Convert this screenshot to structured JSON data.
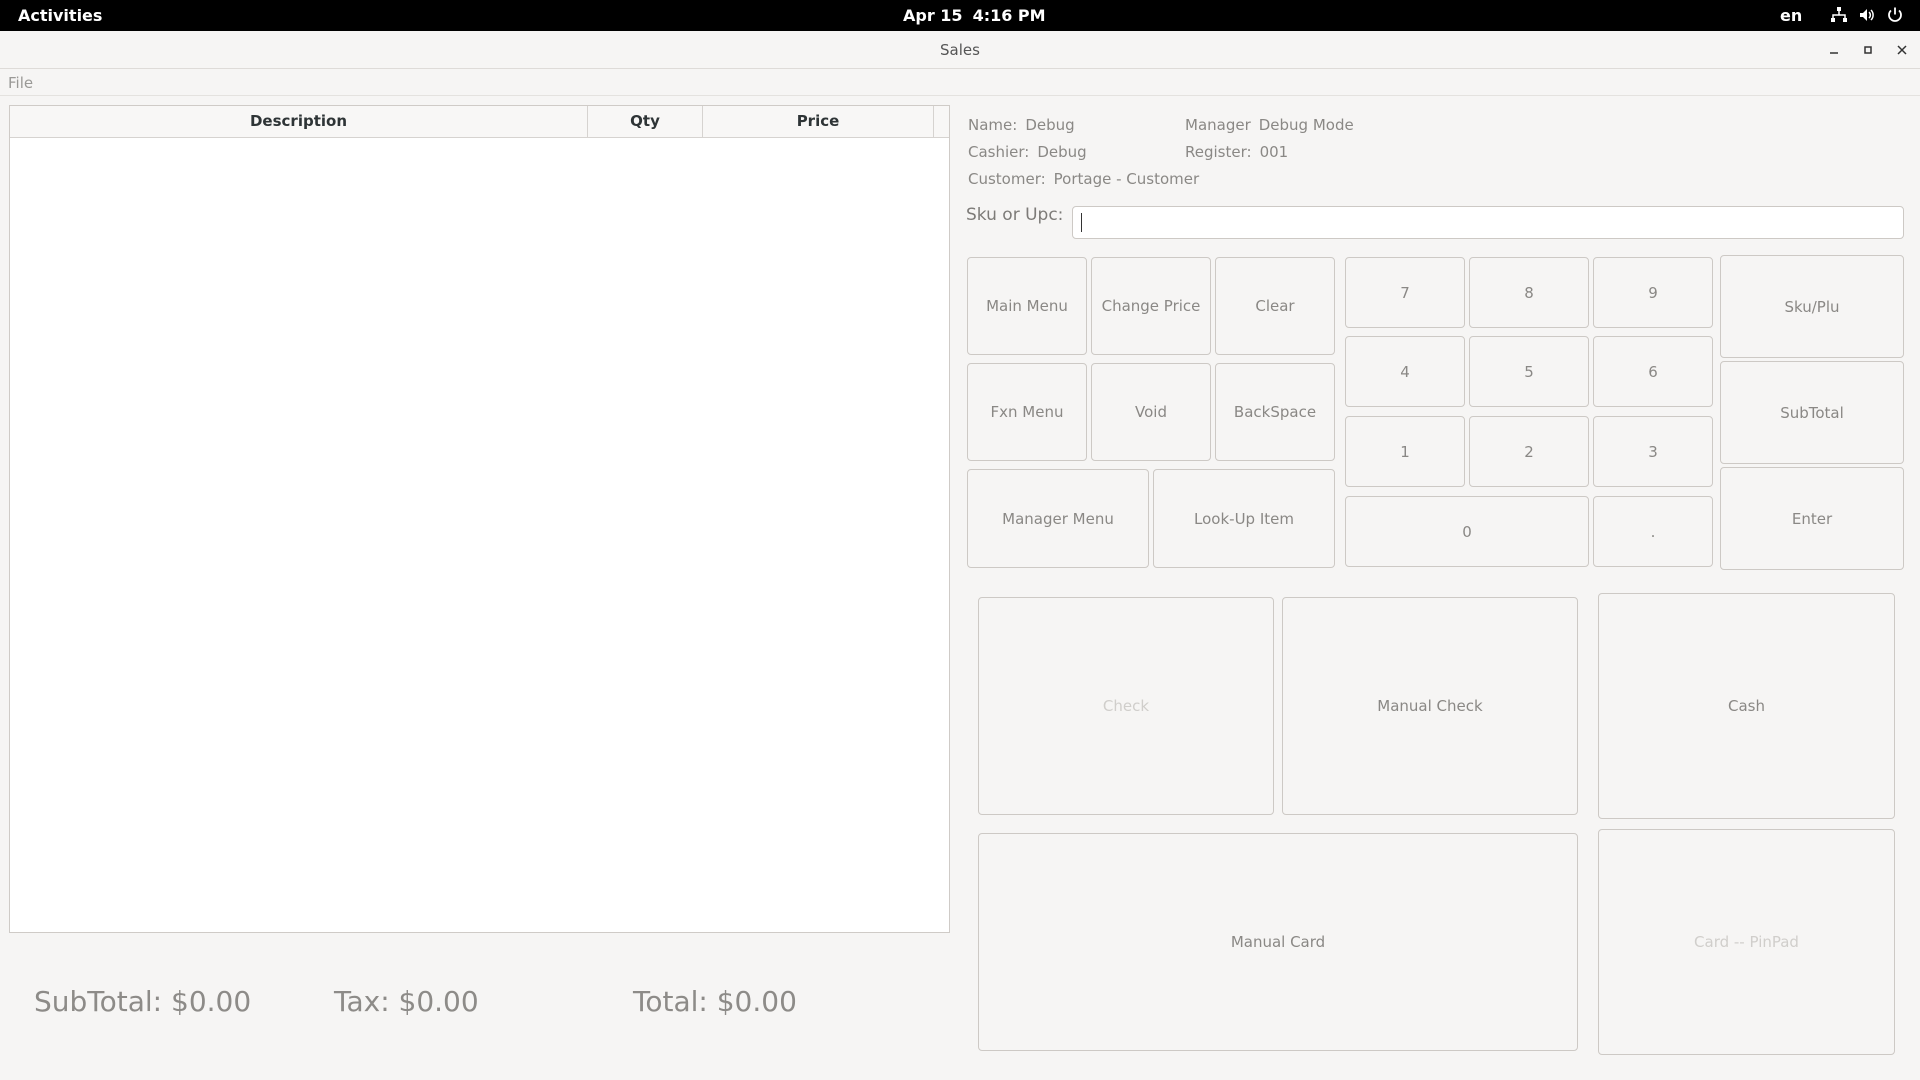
{
  "topbar": {
    "activities": "Activities",
    "date": "Apr 15",
    "time": "4:16 PM",
    "lang": "en",
    "icons": [
      "network-icon",
      "volume-icon",
      "power-icon"
    ]
  },
  "window": {
    "title": "Sales"
  },
  "menubar": {
    "file": "File"
  },
  "table": {
    "columns": [
      "Description",
      "Qty",
      "Price"
    ],
    "rows": []
  },
  "totals": {
    "subtotal": "SubTotal: $0.00",
    "tax": "Tax: $0.00",
    "total": "Total: $0.00"
  },
  "info": {
    "name_label": "Name:",
    "name_value": "Debug",
    "cashier_label": "Cashier:",
    "cashier_value": "Debug",
    "customer_label": "Customer:",
    "customer_value": "Portage - Customer",
    "manager_label": "Manager",
    "manager_value": "Debug Mode",
    "register_label": "Register:",
    "register_value": "001"
  },
  "sku": {
    "label": "Sku or Upc:",
    "value": ""
  },
  "buttons": {
    "main_menu": "Main Menu",
    "change_price": "Change Price",
    "clear": "Clear",
    "fxn_menu": "Fxn Menu",
    "void": "Void",
    "backspace": "BackSpace",
    "manager_menu": "Manager Menu",
    "lookup_item": "Look-Up Item",
    "sku_plu": "Sku/Plu",
    "subtotal": "SubTotal",
    "enter": "Enter",
    "check": "Check",
    "manual_check": "Manual Check",
    "cash": "Cash",
    "manual_card": "Manual Card",
    "card_pinpad": "Card -- PinPad"
  },
  "keypad": {
    "k7": "7",
    "k8": "8",
    "k9": "9",
    "k4": "4",
    "k5": "5",
    "k6": "6",
    "k1": "1",
    "k2": "2",
    "k3": "3",
    "k0": "0",
    "dot": "."
  }
}
